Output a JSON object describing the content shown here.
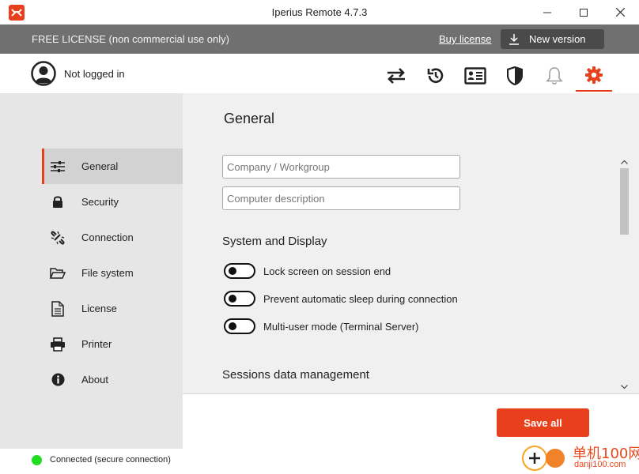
{
  "window": {
    "title": "Iperius Remote 4.7.3",
    "controls": [
      "minimize",
      "maximize",
      "close"
    ]
  },
  "license_bar": {
    "text": "FREE LICENSE (non commercial use only)",
    "buy_link": "Buy license",
    "new_version_label": "New version"
  },
  "top_nav": {
    "login_status": "Not logged in",
    "icons": [
      "transfer-icon",
      "history-icon",
      "contacts-icon",
      "shield-icon",
      "bell-icon",
      "gear-icon"
    ],
    "active": "gear-icon"
  },
  "sidebar": {
    "active": "General",
    "items": [
      {
        "label": "General",
        "icon": "sliders-icon"
      },
      {
        "label": "Security",
        "icon": "lock-icon"
      },
      {
        "label": "Connection",
        "icon": "link-icon"
      },
      {
        "label": "File system",
        "icon": "folder-icon"
      },
      {
        "label": "License",
        "icon": "document-icon"
      },
      {
        "label": "Printer",
        "icon": "printer-icon"
      },
      {
        "label": "About",
        "icon": "info-icon"
      }
    ]
  },
  "main": {
    "title": "General",
    "company_placeholder": "Company / Workgroup",
    "company_value": "",
    "description_placeholder": "Computer description",
    "description_value": "",
    "system_display_heading": "System and Display",
    "toggles": [
      {
        "label": "Lock screen on session end",
        "on": false
      },
      {
        "label": "Prevent automatic sleep during connection",
        "on": false
      },
      {
        "label": "Multi-user mode (Terminal Server)",
        "on": false
      }
    ],
    "sessions_heading": "Sessions data management",
    "save_label": "Save all"
  },
  "status": {
    "text": "Connected (secure connection)",
    "color": "#22dd22"
  },
  "watermark": {
    "site": "单机100网",
    "domain": "danji100.com"
  },
  "colors": {
    "accent": "#e8401c",
    "license_bar": "#707070",
    "sidebar": "#e6e6e6"
  }
}
